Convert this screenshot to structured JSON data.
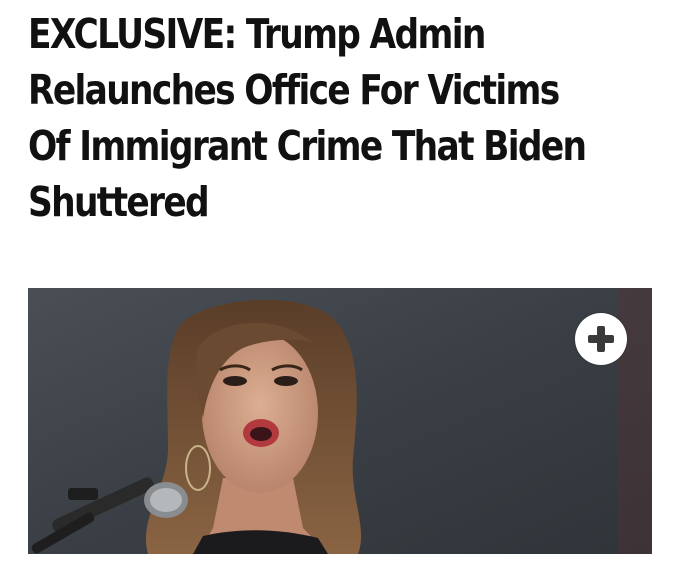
{
  "article": {
    "headline_lines": [
      "EXCLUSIVE: Trump Admin",
      "Relaunches Office For Victims",
      "Of Immigrant Crime That Biden",
      "Shuttered"
    ]
  },
  "media": {
    "expand_icon": "plus-icon",
    "colors": {
      "background": "#3c4147",
      "hair": "#6b4a32",
      "skin": "#c99a80",
      "lips": "#b23a3f",
      "microphone": "#2a2a2a"
    }
  }
}
